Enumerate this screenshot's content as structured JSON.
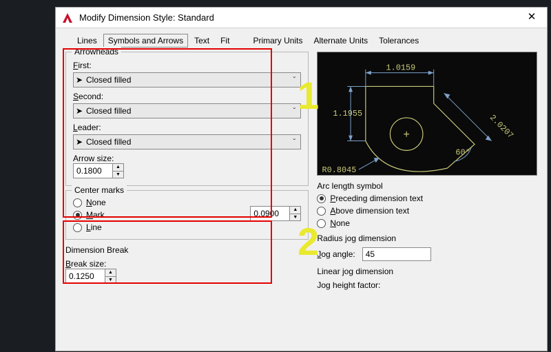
{
  "window": {
    "title": "Modify Dimension Style: Standard"
  },
  "tabs": [
    {
      "label": "Lines"
    },
    {
      "label": "Symbols and Arrows",
      "active": true
    },
    {
      "label": "Text"
    },
    {
      "label": "Fit"
    },
    {
      "label": "Primary Units"
    },
    {
      "label": "Alternate Units"
    },
    {
      "label": "Tolerances"
    }
  ],
  "arrowheads": {
    "title": "Arrowheads",
    "first_label": "First:",
    "first_value": "Closed filled",
    "second_label": "Second:",
    "second_value": "Closed filled",
    "leader_label": "Leader:",
    "leader_value": "Closed filled",
    "arrow_size_label": "Arrow size:",
    "arrow_size_value": "0.1800"
  },
  "center_marks": {
    "title": "Center marks",
    "none_label": "None",
    "mark_label": "Mark",
    "line_label": "Line",
    "selected": "Mark",
    "size_value": "0.0900"
  },
  "dimension_break": {
    "title": "Dimension Break",
    "break_size_label": "Break size:",
    "break_size_value": "0.1250"
  },
  "preview_dims": {
    "top": "1.0159",
    "left": "1.1955",
    "diag": "2.0207",
    "angle": "60°",
    "radius": "R0.8045"
  },
  "arc_length": {
    "title": "Arc length symbol",
    "preceding": "Preceding dimension text",
    "above": "Above dimension text",
    "none": "None",
    "selected": "Preceding dimension text"
  },
  "radius_jog": {
    "title": "Radius jog dimension",
    "jog_angle_label": "Jog angle:",
    "jog_angle_value": "45"
  },
  "linear_jog": {
    "title": "Linear jog dimension",
    "jog_height_label": "Jog height factor:"
  },
  "annotations": {
    "num1": "1",
    "num2": "2"
  }
}
